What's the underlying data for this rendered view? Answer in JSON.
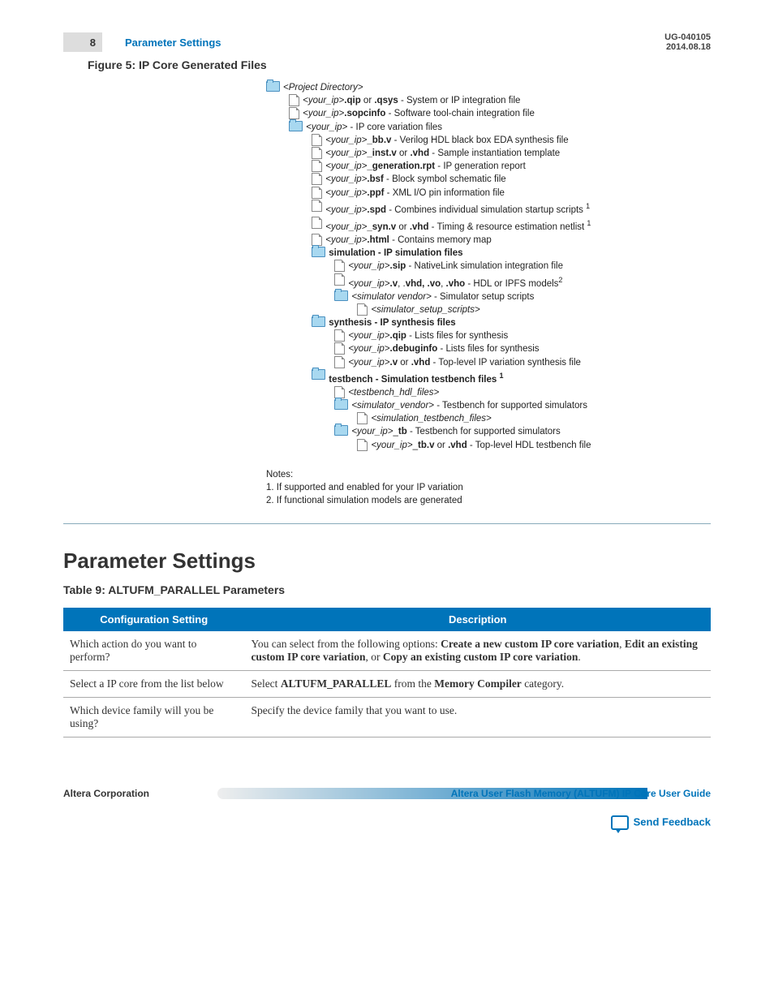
{
  "header": {
    "page": "8",
    "title": "Parameter Settings",
    "doc_id": "UG-040105",
    "date": "2014.08.18"
  },
  "figure": {
    "title": "Figure 5: IP Core Generated Files"
  },
  "tree": [
    {
      "ind": 0,
      "icon": "folder",
      "html": "<span class='it'>&lt;Project Directory&gt;</span>"
    },
    {
      "ind": 1,
      "icon": "file",
      "html": "<span class='it'>&lt;your_ip&gt;</span><b>.qip</b> or <b>.qsys</b> - System or IP integration file"
    },
    {
      "ind": 1,
      "icon": "file",
      "html": "<span class='it'>&lt;your_ip&gt;</span><b>.sopcinfo</b> - Software tool-chain integration file"
    },
    {
      "ind": 1,
      "icon": "folder",
      "html": "<span class='it'>&lt;your_ip&gt;</span> - IP core variation files"
    },
    {
      "ind": 2,
      "icon": "file",
      "html": "<span class='it'>&lt;your_ip&gt;</span><b>_bb.v</b> - Verilog HDL black box EDA synthesis file"
    },
    {
      "ind": 2,
      "icon": "file",
      "html": "<span class='it'>&lt;your_ip&gt;</span><b>_inst.v</b> or <b>.vhd</b> - Sample instantiation template"
    },
    {
      "ind": 2,
      "icon": "file",
      "html": "<span class='it'>&lt;your_ip&gt;</span><b>_generation.rpt</b> - IP generation report"
    },
    {
      "ind": 2,
      "icon": "file",
      "html": "<span class='it'>&lt;your_ip&gt;</span><b>.bsf</b> - Block symbol schematic file"
    },
    {
      "ind": 2,
      "icon": "file",
      "html": "<span class='it'>&lt;your_ip&gt;</span><b>.ppf</b> - XML I/O pin information file"
    },
    {
      "ind": 2,
      "icon": "file",
      "html": "<span class='it'>&lt;your_ip&gt;</span><b>.spd</b> - Combines individual simulation startup scripts <span class='sup'>1</span>"
    },
    {
      "ind": 2,
      "icon": "file",
      "html": "<span class='it'>&lt;your_ip&gt;</span><b>_syn.v</b> or <b>.vhd</b> - Timing &amp; resource estimation netlist <span class='sup'>1</span>"
    },
    {
      "ind": 2,
      "icon": "file",
      "html": "<span class='it'>&lt;your_ip&gt;</span><b>.html</b> - Contains memory map"
    },
    {
      "ind": 2,
      "icon": "folder",
      "html": "<b>simulation - IP simulation files</b>"
    },
    {
      "ind": 3,
      "icon": "file",
      "html": "<span class='it'>&lt;your_ip&gt;</span><b>.sip</b> - NativeLink simulation integration file"
    },
    {
      "ind": 3,
      "icon": "file",
      "html": "<span class='it'>&lt;your_ip&gt;</span><b>.v</b>, .<b>vhd, .vo</b>, <b>.vho</b> - HDL or IPFS models<span class='sup'>2</span>"
    },
    {
      "ind": 3,
      "icon": "folder",
      "html": "<span class='it'>&lt;simulator vendor&gt;</span> - Simulator setup scripts"
    },
    {
      "ind": 4,
      "icon": "file",
      "html": "<span class='it'>&lt;simulator_setup_scripts&gt;</span>"
    },
    {
      "ind": 2,
      "icon": "folder",
      "html": "<b>synthesis - IP synthesis files</b>"
    },
    {
      "ind": 3,
      "icon": "file",
      "html": "<span class='it'>&lt;your_ip&gt;</span><b>.qip</b> - Lists files for synthesis"
    },
    {
      "ind": 3,
      "icon": "file",
      "html": "<span class='it'>&lt;your_ip&gt;</span><b>.debuginfo</b> - Lists files for synthesis"
    },
    {
      "ind": 3,
      "icon": "file",
      "html": "<span class='it'>&lt;your_ip&gt;</span><b>.v</b> or <b>.vhd</b> - Top-level IP variation synthesis file"
    },
    {
      "ind": 2,
      "icon": "folder",
      "html": "<b>testbench - Simulation testbench files <span class='sup'>1</span></b>"
    },
    {
      "ind": 3,
      "icon": "file",
      "html": "<span class='it'>&lt;testbench_hdl_files&gt;</span>"
    },
    {
      "ind": 3,
      "icon": "folder",
      "html": "<span class='it'>&lt;simulator_vendor&gt;</span> - Testbench for supported simulators"
    },
    {
      "ind": 4,
      "icon": "file",
      "html": "<span class='it'>&lt;simulation_testbench_files&gt;</span>"
    },
    {
      "ind": 3,
      "icon": "folder",
      "html": "<span class='it'>&lt;your_ip&gt;</span>_<b>tb</b> - Testbench for supported simulators"
    },
    {
      "ind": 4,
      "icon": "file",
      "html": "<span class='it'>&lt;your_ip&gt;</span>_<b>tb.v</b> or <b>.vhd</b> - Top-level HDL testbench file"
    }
  ],
  "notes": {
    "heading": "Notes:",
    "n1": "1. If supported and enabled for your IP variation",
    "n2": "2. If functional simulation models are generated"
  },
  "h1": "Parameter Settings",
  "table": {
    "title": "Table 9: ALTUFM_PARALLEL Parameters",
    "th1": "Configuration Setting",
    "th2": "Description",
    "rows": [
      {
        "c1": "Which action do you want to perform?",
        "c2": "You can select from the following options: <b>Create a new custom IP core variation</b>, <b>Edit an existing custom IP core variation</b>, or <b>Copy an existing custom IP core variation</b>."
      },
      {
        "c1": "Select a IP core from the list below",
        "c2": "Select <b>ALTUFM_PARALLEL</b> from the <b>Memory Compiler</b> category."
      },
      {
        "c1": "Which device family will you be using?",
        "c2": "Specify the device family that you want to use."
      }
    ]
  },
  "footer": {
    "left": "Altera Corporation",
    "right": "Altera User Flash Memory (ALTUFM) IP Core User Guide",
    "feedback": "Send Feedback"
  }
}
